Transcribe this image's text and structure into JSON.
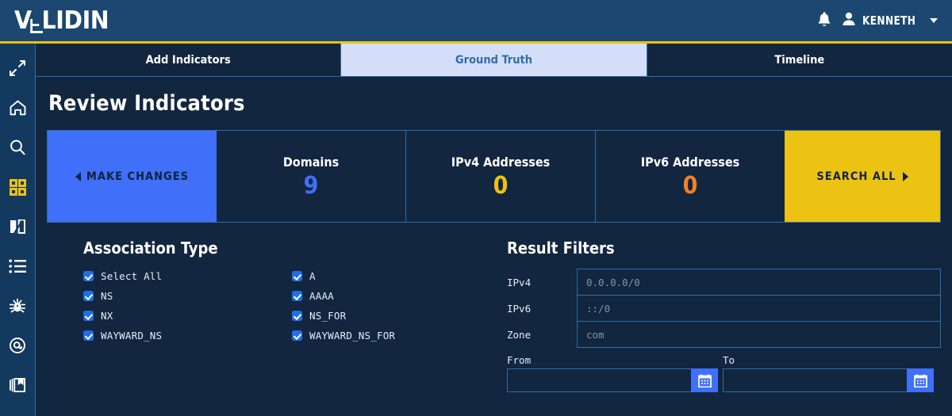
{
  "header": {
    "logo_text": "VALIDIN",
    "logo_v": "V",
    "logo_tail": "LIDIN",
    "bell_icon": "bell-icon",
    "user_icon": "user-icon",
    "user_name": "KENNETH",
    "caret_icon": "chevron-down-icon"
  },
  "sidebar": {
    "items": [
      {
        "icon": "expand-arrows-icon",
        "active": false
      },
      {
        "icon": "home-icon",
        "active": false
      },
      {
        "icon": "search-icon",
        "active": false
      },
      {
        "icon": "grid-apps-icon",
        "active": true
      },
      {
        "icon": "compare-split-icon",
        "active": false
      },
      {
        "icon": "list-icon",
        "active": false
      },
      {
        "icon": "bug-icon",
        "active": false
      },
      {
        "icon": "target-at-icon",
        "active": false
      },
      {
        "icon": "bookmark-library-icon",
        "active": false
      }
    ],
    "active_color": "#ecc213",
    "icon_color": "#ffffff"
  },
  "tabs": [
    {
      "label": "Add Indicators",
      "active": false
    },
    {
      "label": "Ground Truth",
      "active": true
    },
    {
      "label": "Timeline",
      "active": false
    }
  ],
  "page": {
    "title": "Review Indicators"
  },
  "stat_bar": {
    "make_changes_label": "MAKE CHANGES",
    "make_changes_icon": "chevron-left-icon",
    "search_all_label": "SEARCH ALL",
    "search_all_icon": "chevron-right-icon",
    "stats": [
      {
        "label": "Domains",
        "value": "9",
        "color": "#4070fa"
      },
      {
        "label": "IPv4 Addresses",
        "value": "0",
        "color": "#ecc213"
      },
      {
        "label": "IPv6 Addresses",
        "value": "0",
        "color": "#f28125"
      }
    ]
  },
  "association_type": {
    "title": "Association Type",
    "options": [
      {
        "label": "Select All",
        "checked": true
      },
      {
        "label": "A",
        "checked": true
      },
      {
        "label": "NS",
        "checked": true
      },
      {
        "label": "AAAA",
        "checked": true
      },
      {
        "label": "NX",
        "checked": true
      },
      {
        "label": "NS_FOR",
        "checked": true
      },
      {
        "label": "WAYWARD_NS",
        "checked": true
      },
      {
        "label": "WAYWARD_NS_FOR",
        "checked": true
      }
    ]
  },
  "result_filters": {
    "title": "Result Filters",
    "fields": [
      {
        "label": "IPv4",
        "value": "",
        "placeholder": "0.0.0.0/0"
      },
      {
        "label": "IPv6",
        "value": "",
        "placeholder": "::/0"
      },
      {
        "label": "Zone",
        "value": "",
        "placeholder": "com"
      }
    ],
    "from_label": "From",
    "to_label": "To",
    "from_value": "",
    "to_value": "",
    "from_placeholder": "",
    "to_placeholder": "",
    "calendar_icon": "calendar-icon"
  },
  "colors": {
    "header_bg": "#1b4770",
    "header_rule": "#e8c111",
    "panel_bg": "#12263f",
    "rail_bg": "#13395f",
    "border": "#2f6da8",
    "accent_blue": "#4070fa",
    "accent_yellow": "#ecc213",
    "active_tab_bg": "#d5def8"
  }
}
